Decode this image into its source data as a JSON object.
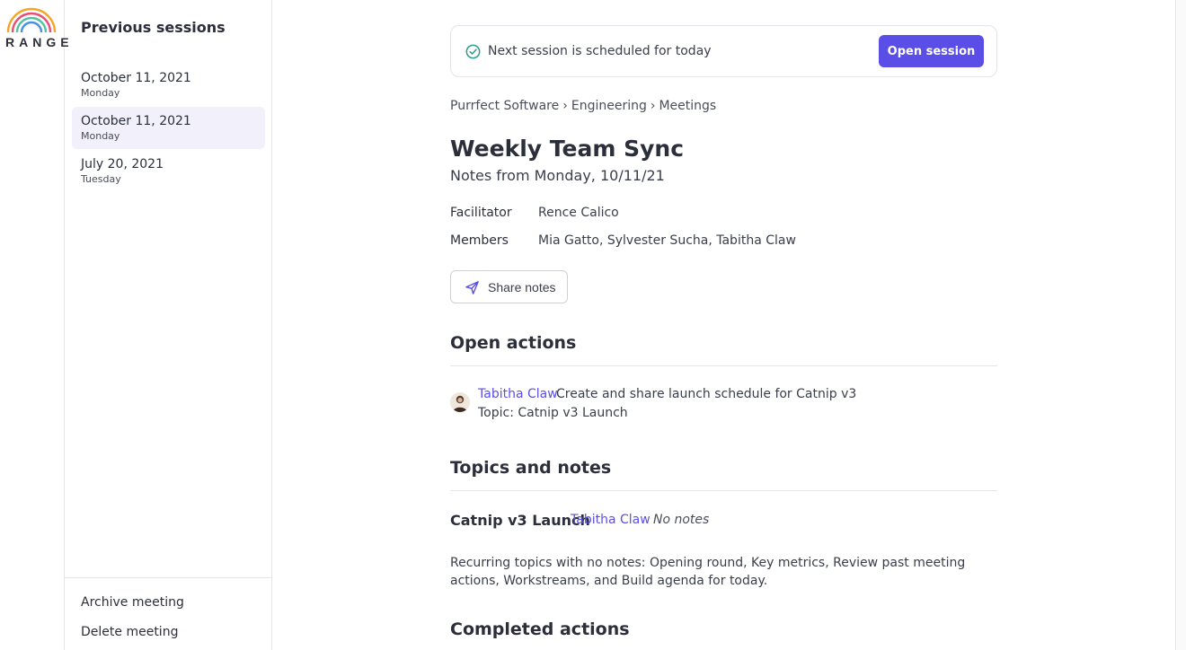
{
  "brand": {
    "logo_text": "RANGE"
  },
  "sidebar": {
    "title": "Previous sessions",
    "sessions": [
      {
        "date": "October 11, 2021",
        "day": "Monday",
        "selected": false
      },
      {
        "date": "October 11, 2021",
        "day": "Monday",
        "selected": true
      },
      {
        "date": "July 20, 2021",
        "day": "Tuesday",
        "selected": false
      }
    ],
    "archive_label": "Archive meeting",
    "delete_label": "Delete meeting"
  },
  "banner": {
    "text": "Next session is scheduled for today",
    "button_label": "Open session"
  },
  "breadcrumb": {
    "items": [
      "Purrfect Software",
      "Engineering",
      "Meetings"
    ],
    "separator": "›"
  },
  "meeting": {
    "title": "Weekly Team Sync",
    "subtitle": "Notes from Monday, 10/11/21",
    "facilitator_label": "Facilitator",
    "facilitator": "Rence Calico",
    "members_label": "Members",
    "members": "Mia Gatto, Sylvester Sucha, Tabitha Claw",
    "share_label": "Share notes"
  },
  "open_actions": {
    "title": "Open actions",
    "items": [
      {
        "owner": "Tabitha Claw",
        "text": "Create and share launch schedule for Catnip v3",
        "topic": "Topic: Catnip v3 Launch"
      }
    ]
  },
  "topics": {
    "title": "Topics and notes",
    "items": [
      {
        "name": "Catnip v3 Launch",
        "owner": "Tabitha Claw",
        "notes": "No notes",
        "description": "Recurring topics with no notes: Opening round, Key metrics, Review past meeting actions, Workstreams, and Build agenda for today."
      }
    ]
  },
  "completed_actions": {
    "title": "Completed actions"
  },
  "colors": {
    "accent": "#5b4ee6",
    "selected_bg": "#f1f0fb",
    "text": "#2b2f3a",
    "border": "#e6e6ea"
  }
}
